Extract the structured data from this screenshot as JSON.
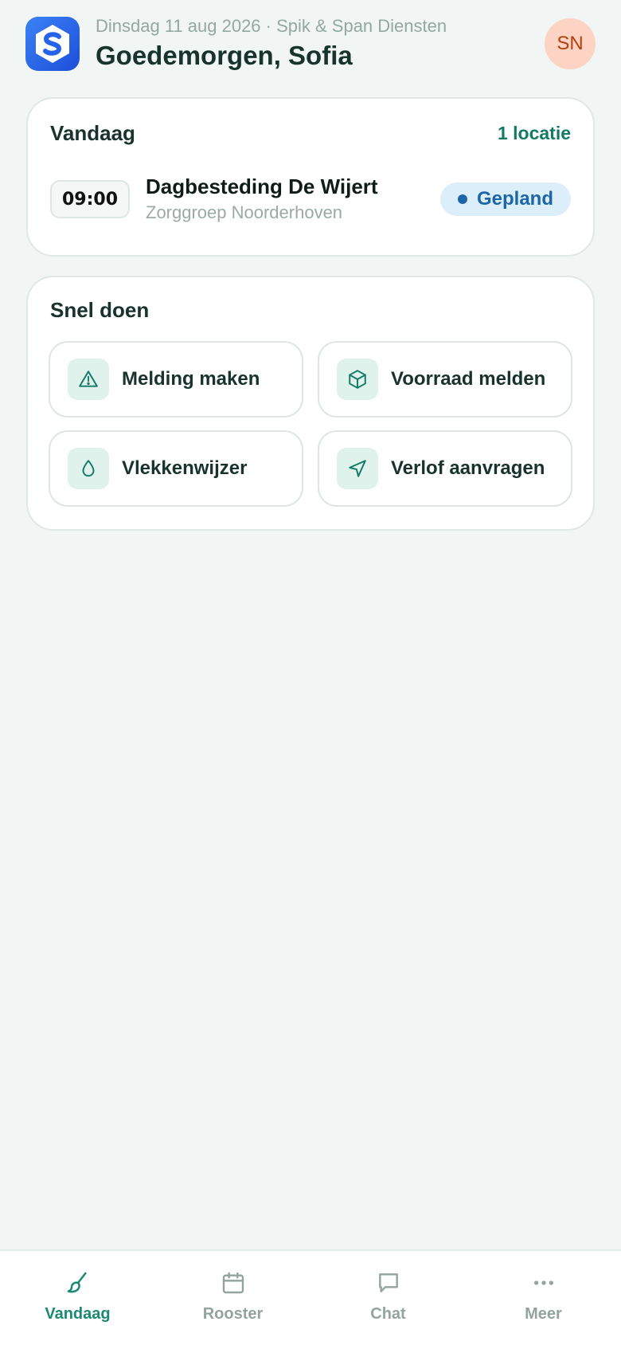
{
  "header": {
    "subtitle": "Dinsdag 11 aug 2026 · Spik & Span Diensten",
    "greeting": "Goedemorgen, Sofia",
    "avatar_initials": "SN",
    "logo_letter": "S"
  },
  "today": {
    "title": "Vandaag",
    "location_count": "1 locatie",
    "appointment": {
      "time": "09:00",
      "title": "Dagbesteding De Wijert",
      "subtitle": "Zorggroep Noorderhoven",
      "status": "Gepland"
    }
  },
  "quick_actions": {
    "title": "Snel doen",
    "items": [
      {
        "label": "Melding maken",
        "icon": "warning-icon"
      },
      {
        "label": "Voorraad melden",
        "icon": "box-icon"
      },
      {
        "label": "Vlekkenwijzer",
        "icon": "droplet-icon"
      },
      {
        "label": "Verlof aanvragen",
        "icon": "send-icon"
      }
    ]
  },
  "nav": {
    "items": [
      {
        "label": "Vandaag",
        "icon": "brush-icon",
        "active": true
      },
      {
        "label": "Rooster",
        "icon": "calendar-icon",
        "active": false
      },
      {
        "label": "Chat",
        "icon": "chat-icon",
        "active": false
      },
      {
        "label": "Meer",
        "icon": "more-icon",
        "active": false
      }
    ]
  },
  "colors": {
    "accent": "#137a66",
    "status_planned": "#1c66a8",
    "logo_blue": "#2563eb",
    "avatar_bg": "#fdd3c4"
  }
}
